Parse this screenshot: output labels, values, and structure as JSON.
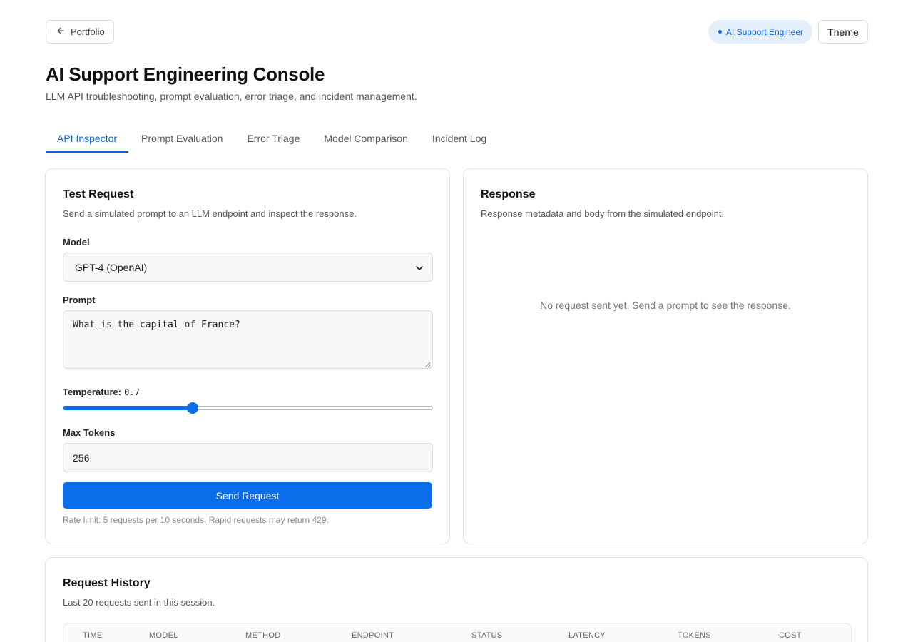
{
  "header": {
    "back_label": "Portfolio",
    "role_badge": "AI Support Engineer",
    "theme_label": "Theme",
    "title": "AI Support Engineering Console",
    "subtitle": "LLM API troubleshooting, prompt evaluation, error triage, and incident management."
  },
  "tabs": [
    {
      "label": "API Inspector",
      "active": true
    },
    {
      "label": "Prompt Evaluation",
      "active": false
    },
    {
      "label": "Error Triage",
      "active": false
    },
    {
      "label": "Model Comparison",
      "active": false
    },
    {
      "label": "Incident Log",
      "active": false
    }
  ],
  "request": {
    "title": "Test Request",
    "description": "Send a simulated prompt to an LLM endpoint and inspect the response.",
    "model_label": "Model",
    "model_value": "GPT-4 (OpenAI)",
    "prompt_label": "Prompt",
    "prompt_value": "What is the capital of France?",
    "temperature_label": "Temperature:",
    "temperature_value": "0.7",
    "temperature_fraction": 0.35,
    "max_tokens_label": "Max Tokens",
    "max_tokens_value": "256",
    "send_label": "Send Request",
    "rate_note": "Rate limit: 5 requests per 10 seconds. Rapid requests may return 429."
  },
  "response": {
    "title": "Response",
    "description": "Response metadata and body from the simulated endpoint.",
    "empty_message": "No request sent yet. Send a prompt to see the response."
  },
  "history": {
    "title": "Request History",
    "description": "Last 20 requests sent in this session.",
    "columns": [
      "TIME",
      "MODEL",
      "METHOD",
      "ENDPOINT",
      "STATUS",
      "LATENCY",
      "TOKENS",
      "COST"
    ]
  },
  "colors": {
    "accent": "#0a6ee8",
    "badge_bg": "#e4effc",
    "badge_text": "#0a63d9"
  },
  "icons": {
    "back": "arrow-left-icon",
    "select": "chevron-down-icon"
  }
}
